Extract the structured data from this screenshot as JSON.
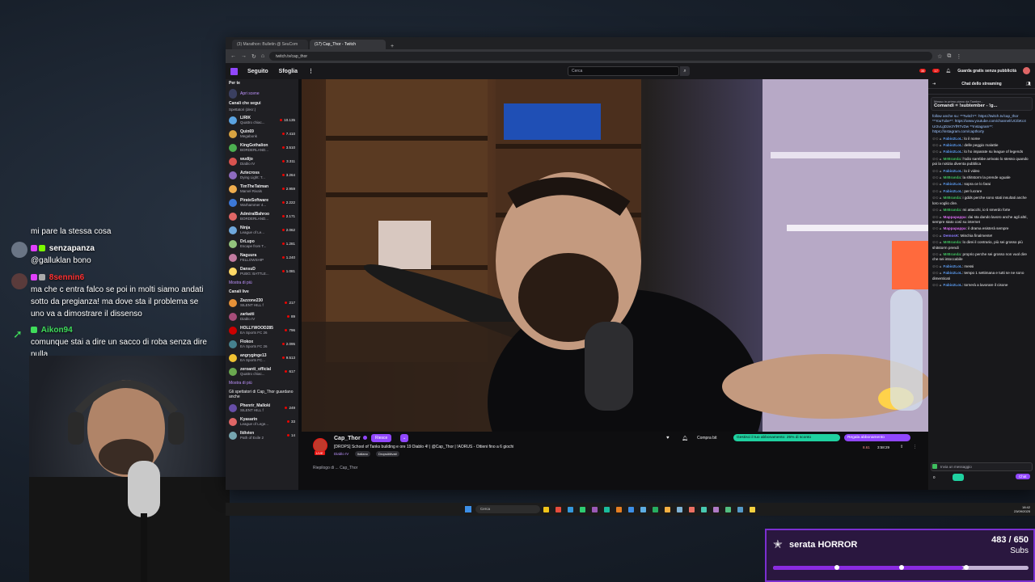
{
  "overlay_chat": [
    {
      "user": "",
      "text": "mi pare la stessa cosa",
      "color": "#ffffff"
    },
    {
      "user": "senzapanza",
      "text": "@galluklan bono",
      "color": "#ffffff"
    },
    {
      "user": "8sennin6",
      "text": "ma che c entra falco se poi in molti siamo andati sotto da pregianza! ma dove sta il problema se uno va a dimostrare il dissenso",
      "color": "#ff3030"
    },
    {
      "user": "Aikon94",
      "text": "comunque stai a dire un sacco di roba senza dire nulla",
      "color": "#3fdc5a"
    }
  ],
  "browser": {
    "tabs": [
      "(3) Marathon: Bulletin @ SeuCom",
      "(17) Cap_Thor - Twitch"
    ],
    "url": "twitch.tv/cap_thor"
  },
  "twitch": {
    "nav": [
      "Seguito",
      "Sfoglia"
    ],
    "search_placeholder": "Cerca",
    "prime_label": "Guarda gratis senza pubblicità",
    "notif1": "35",
    "notif2": "17"
  },
  "sidebar": {
    "for_you": "Per te",
    "open_label": "Apri scene",
    "followed_title": "Canali che segui",
    "followed_sub": "Spettatori (decr.)",
    "followed": [
      {
        "name": "LIRIK",
        "game": "Quattro chiac...",
        "count": "10.135",
        "color": "#5ba3e0"
      },
      {
        "name": "Quin69",
        "game": "Megabonk",
        "count": "7.410",
        "color": "#d9a441"
      },
      {
        "name": "KingGothalion",
        "game": "BORDERLAND...",
        "count": "3.510",
        "color": "#4caf50"
      },
      {
        "name": "wudijo",
        "game": "Diablo IV",
        "count": "3.311",
        "color": "#d9534f"
      },
      {
        "name": "Aztecross",
        "game": "Dying Light: T...",
        "count": "3.264",
        "color": "#8e6bbf"
      },
      {
        "name": "TimTheTatman",
        "game": "Marvel Rivals",
        "count": "2.959",
        "color": "#f0ad4e"
      },
      {
        "name": "PirateSoftware",
        "game": "Warhammer 4...",
        "count": "2.222",
        "color": "#3c78d8"
      },
      {
        "name": "AdmiralBahroo",
        "game": "BORDERLAND...",
        "count": "2.171",
        "color": "#e06666"
      },
      {
        "name": "Ninja",
        "game": "League of Le...",
        "count": "2.062",
        "color": "#6fa8dc"
      },
      {
        "name": "DrLupo",
        "game": "Escape from T...",
        "count": "1.281",
        "color": "#93c47d"
      },
      {
        "name": "Naguura",
        "game": "FELLOWSHIP",
        "count": "1.240",
        "color": "#c27ba0"
      },
      {
        "name": "DansuD",
        "game": "PUBG: BATTLE...",
        "count": "1.081",
        "color": "#ffd966"
      }
    ],
    "more_label": "Mostra di più",
    "live_title": "Canali live",
    "live": [
      {
        "name": "Zazzone230",
        "game": "SILENT HILL f",
        "count": "217",
        "color": "#e69138"
      },
      {
        "name": "zarkatti",
        "game": "Diablo IV",
        "count": "89",
        "color": "#a64d79"
      },
      {
        "name": "HOLLYWOOD285",
        "game": "EA Sports FC 26",
        "count": "796",
        "color": "#cc0000"
      },
      {
        "name": "Flokox",
        "game": "EA Sports FC 26",
        "count": "2.095",
        "color": "#45818e"
      },
      {
        "name": "angryginge13",
        "game": "EA Sports FC...",
        "count": "9.513",
        "color": "#f1c232"
      },
      {
        "name": "zeroanti_official",
        "game": "Quattro chiac...",
        "count": "617",
        "color": "#6aa84f"
      }
    ],
    "more_label2": "Mostra di più",
    "viewers_title": "Gli spettatori di Cap_Thor guardano anche",
    "viewers": [
      {
        "name": "Phenrir_Malloki",
        "game": "SILENT HILL f",
        "count": "249",
        "color": "#674ea7"
      },
      {
        "name": "Kyasarin",
        "game": "League of Lege...",
        "count": "33",
        "color": "#e06666"
      },
      {
        "name": "Ildivien",
        "game": "Path of Exile 2",
        "count": "14",
        "color": "#76a5af"
      }
    ]
  },
  "stream": {
    "channel": "Cap_Thor",
    "follow_label": "Riesce",
    "title": "[DROPS] School of Tanks building e ore 19 Diablo 4! | @Cap_Thor | !AORUS - Ottieni fino a 6 giochi",
    "game": "Diablo IV",
    "tags": [
      "Italiano",
      "DropsAttivati"
    ],
    "buy_bits": "Compra bit",
    "manage_sub": "Gestisci il tuo abbonamento: 25% di sconto",
    "gift_sub": "Regala abbonamento",
    "viewers": "8.61",
    "uptime": "3:58:29",
    "about": "Riepilogo di ... Cap_Thor"
  },
  "chat": {
    "title": "Chat dello streaming",
    "pinned_by": "Messo in primo piano da Tamber...",
    "pinned_title": "Comandi = !subtember - !g...",
    "pinned_text": "follow anche su: **Twitch**: https://twitch.tv/cap_thor **YouTube**: https://www.youtube.com/channel/UCIbKc4 Ur2vLgD2e3YfRTvDw **Instagram**: https://instagram.com/capthorty",
    "messages": [
      {
        "user": "Fabio2LoL",
        "text": "lo il nome",
        "color": "#5b9bf0"
      },
      {
        "user": "Fabio2LoL",
        "text": "delle peggio malattie",
        "color": "#5b9bf0"
      },
      {
        "user": "Fabio2LoL",
        "text": "lo ho imparate su league of legends",
        "color": "#5b9bf0"
      },
      {
        "user": "MrBranda",
        "text": "l'odio sarebbe arrivato lo stesso quando poi la notizia diventa pubblica",
        "color": "#3fbf5f"
      },
      {
        "user": "Fabio2LoL",
        "text": "lo il video",
        "color": "#5b9bf0"
      },
      {
        "user": "MrBranda",
        "text": "la shitstorm la prende uguale",
        "color": "#3fbf5f"
      },
      {
        "user": "Fabio2LoL",
        "text": "sopra ce lo farai",
        "color": "#5b9bf0"
      },
      {
        "user": "Fabio2LoL",
        "text": "per lucrare",
        "color": "#5b9bf0"
      },
      {
        "user": "MrBranda",
        "text": "i gdds perche sono stati insultati anche loro voglio dire.",
        "color": "#3fbf5f"
      },
      {
        "user": "MrBranda",
        "text": "mi attacchi, io ti smerdo forte",
        "color": "#3fbf5f"
      },
      {
        "user": "Mappapappa",
        "text": "dai sta dando lavoro anche agli altri, sempre stato così su internet",
        "color": "#d96cf0"
      },
      {
        "user": "Mappapappa",
        "text": "il drama esisterà sempre",
        "color": "#d96cf0"
      },
      {
        "user": "DemosK",
        "text": "Minchia finalmente!",
        "color": "#8c7bff"
      },
      {
        "user": "MrBranda",
        "text": "lo direi il contrario, più sei grosso più shitstorm prendi",
        "color": "#3fbf5f"
      },
      {
        "user": "MrBranda",
        "text": "proprio perche sei grosso non vuol dire che sei intoccabile",
        "color": "#3fbf5f"
      },
      {
        "user": "Fabio2LoL",
        "text": "messi",
        "color": "#5b9bf0"
      },
      {
        "user": "Fabio2LoL",
        "text": "tempo 1 settimana e tutti se ne sono dimenticati",
        "color": "#5b9bf0"
      },
      {
        "user": "Fabio2LoL",
        "text": "tornerà a lavorare il cisone",
        "color": "#5b9bf0"
      }
    ],
    "input_placeholder": "Invia un messaggio",
    "points": "0",
    "chat_button": "Chat"
  },
  "taskbar": {
    "search_label": "Cerca",
    "time": "18:42",
    "date": "23/09/2025"
  },
  "subs_goal": {
    "title": "serata HORROR",
    "count": "483 / 650",
    "unit": "Subs",
    "progress": 0.743
  }
}
